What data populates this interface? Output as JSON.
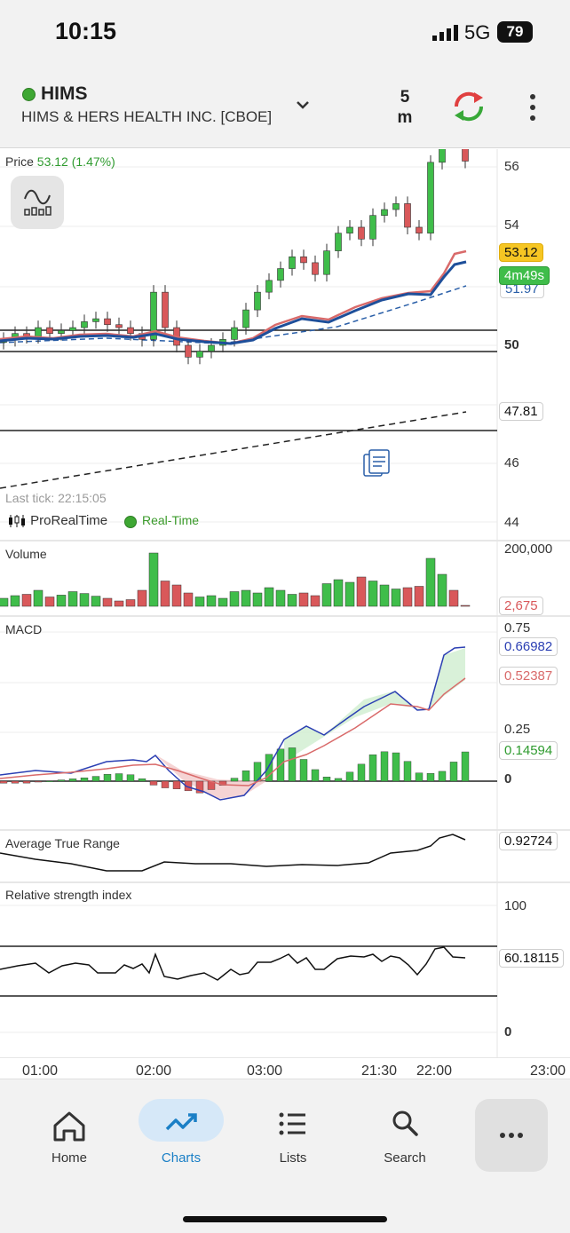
{
  "status_bar": {
    "time": "10:15",
    "network": "5G",
    "battery": "79"
  },
  "header": {
    "symbol": "HIMS",
    "company": "HIMS & HERS HEALTH INC. [CBOE]",
    "timeframe_value": "5",
    "timeframe_unit": "m"
  },
  "price_panel": {
    "label": "Price",
    "price": "53.12",
    "change": "(1.47%)",
    "y_ticks": [
      "56",
      "54",
      "50",
      "46",
      "44"
    ],
    "last_price_tag": "53.12",
    "countdown_tag": "4m49s",
    "ma_tag": "51.97",
    "trend_tag": "47.81",
    "last_tick": "Last tick: 22:15:05",
    "source": "ProRealTime",
    "realtime": "Real-Time"
  },
  "volume_panel": {
    "label": "Volume",
    "axis_top": "200,000",
    "last_tag": "2,675"
  },
  "macd_panel": {
    "label": "MACD",
    "ticks": [
      "0.75",
      "0.25",
      "0"
    ],
    "macd_tag": "0.66982",
    "signal_tag": "0.52387",
    "hist_tag": "0.14594"
  },
  "atr_panel": {
    "label": "Average True Range",
    "value_tag": "0.92724"
  },
  "rsi_panel": {
    "label": "Relative strength index",
    "ticks": [
      "100",
      "0"
    ],
    "value_tag": "60.18115"
  },
  "x_axis": [
    "01:00",
    "02:00",
    "03:00",
    "21:30",
    "22:00",
    "23:00"
  ],
  "nav": {
    "home": "Home",
    "charts": "Charts",
    "lists": "Lists",
    "search": "Search"
  },
  "colors": {
    "up": "#3fbd4a",
    "down": "#d9585a",
    "macd": "#2b3fb3",
    "signal": "#d96a6a",
    "accent": "#1a7fc6"
  },
  "chart_data": {
    "type": "candlestick",
    "price_series": [
      50.1,
      50.2,
      50.15,
      50.3,
      50.2,
      50.25,
      50.3,
      50.4,
      50.45,
      50.35,
      50.3,
      50.2,
      50.1,
      50.9,
      50.3,
      50.0,
      49.8,
      49.9,
      50.0,
      50.1,
      50.3,
      50.6,
      50.9,
      51.1,
      51.3,
      51.5,
      51.4,
      51.2,
      51.6,
      51.9,
      52.0,
      51.8,
      52.2,
      52.3,
      52.4,
      52.0,
      51.9,
      53.1,
      54.0,
      53.5,
      53.12
    ],
    "volume": [
      30000,
      40000,
      45000,
      60000,
      35000,
      42000,
      55000,
      48000,
      38000,
      30000,
      20000,
      25000,
      60000,
      200000,
      95000,
      80000,
      50000,
      35000,
      40000,
      30000,
      55000,
      60000,
      50000,
      70000,
      60000,
      45000,
      50000,
      40000,
      85000,
      100000,
      90000,
      110000,
      95000,
      80000,
      65000,
      70000,
      75000,
      180000,
      120000,
      60000,
      2675
    ],
    "macd": [
      0.0,
      0.01,
      0.03,
      0.05,
      0.07,
      0.1,
      0.08,
      -0.05,
      -0.12,
      -0.18,
      -0.1,
      0.05,
      0.25,
      0.4,
      0.35,
      0.3,
      0.4,
      0.55,
      0.6,
      0.45,
      0.5,
      0.66982
    ],
    "signal": [
      0.01,
      0.02,
      0.03,
      0.04,
      0.05,
      0.06,
      0.05,
      -0.02,
      -0.08,
      -0.12,
      -0.08,
      0.0,
      0.12,
      0.22,
      0.28,
      0.3,
      0.34,
      0.4,
      0.46,
      0.42,
      0.45,
      0.52387
    ],
    "atr_last": 0.92724,
    "rsi_last": 60.18115
  }
}
